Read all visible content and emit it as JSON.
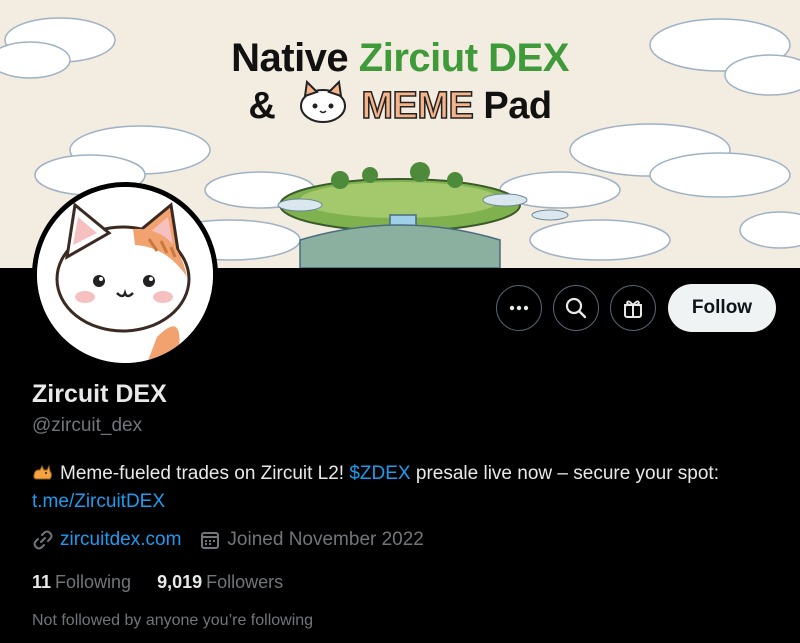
{
  "banner": {
    "line1_a": "Native ",
    "line1_b": "Zirciut DEX",
    "line2_a": "& ",
    "line2_meme": "MEME",
    "line2_b": " Pad"
  },
  "profile": {
    "name": "Zircuit DEX",
    "handle": "@zircuit_dex",
    "bio_text": "Meme-fueled trades on Zircuit L2! ",
    "bio_cashtag": "$ZDEX",
    "bio_text2": " presale live now – secure your spot:",
    "bio_link": "t.me/ZircuitDEX",
    "website": "zircuitdex.com",
    "joined": "Joined November 2022"
  },
  "stats": {
    "following_count": "11",
    "following_label": "Following",
    "followers_count": "9,019",
    "followers_label": "Followers"
  },
  "actions": {
    "follow_label": "Follow",
    "more_icon": "more-icon",
    "search_icon": "search-icon",
    "gift_icon": "gift-icon"
  },
  "footer_note": "Not followed by anyone you’re following",
  "colors": {
    "background": "#000000",
    "link": "#1d9bf0",
    "muted": "#71767b",
    "text": "#e7e9ea",
    "follow_button": "#eff3f4",
    "brand_green": "#3f9a3a"
  }
}
